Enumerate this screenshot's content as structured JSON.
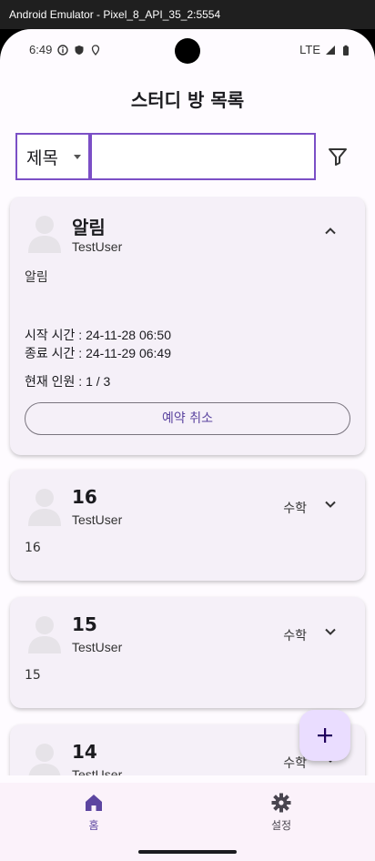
{
  "window": {
    "title": "Android Emulator - Pixel_8_API_35_2:5554"
  },
  "status_bar": {
    "time": "6:49",
    "network": "LTE"
  },
  "app": {
    "title": "스터디 방 목록"
  },
  "search": {
    "field_selected": "제목",
    "query": ""
  },
  "rooms": [
    {
      "title": "알림",
      "author": "TestUser",
      "category": "",
      "description": "알림",
      "expanded": true,
      "start_time": "시작 시간 : 24-11-28 06:50",
      "end_time": "종료 시간 : 24-11-29 06:49",
      "members": "현재 인원 : 1 / 3",
      "action_label": "예약 취소"
    },
    {
      "title": "16",
      "author": "TestUser",
      "category": "수학",
      "description": "16",
      "expanded": false
    },
    {
      "title": "15",
      "author": "TestUser",
      "category": "수학",
      "description": "15",
      "expanded": false
    },
    {
      "title": "14",
      "author": "TestUser",
      "category": "수학",
      "description": "",
      "expanded": false
    }
  ],
  "fab": {
    "icon": "plus-icon"
  },
  "bottom_nav": [
    {
      "label": "홈",
      "icon": "home-icon",
      "active": true
    },
    {
      "label": "설정",
      "icon": "gear-icon",
      "active": false
    }
  ],
  "colors": {
    "accent": "#7b4fc6",
    "card_bg": "#f5f0f8",
    "fab_bg": "#eaddff",
    "nav_active": "#5c45a0"
  }
}
